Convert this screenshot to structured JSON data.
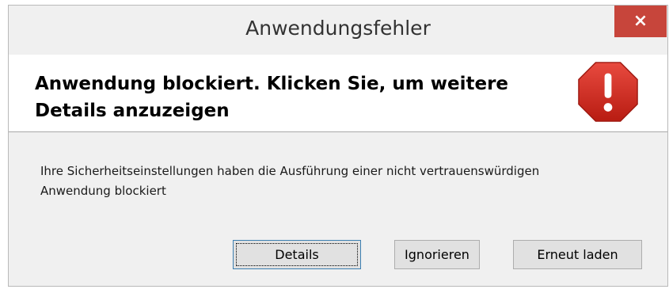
{
  "window": {
    "title": "Anwendungsfehler",
    "close_label": "×"
  },
  "header": {
    "headline": "Anwendung blockiert. Klicken Sie, um weitere Details anzuzeigen",
    "icon": "error-stop-sign-icon",
    "icon_color": "#d42020"
  },
  "body": {
    "message": "Ihre Sicherheitseinstellungen haben die Ausführung einer nicht vertrauenswürdigen Anwendung blockiert"
  },
  "buttons": {
    "details": "Details",
    "ignore": "Ignorieren",
    "reload": "Erneut laden"
  },
  "colors": {
    "close_button": "#c7453b",
    "dialog_background": "#f0f0f0"
  }
}
